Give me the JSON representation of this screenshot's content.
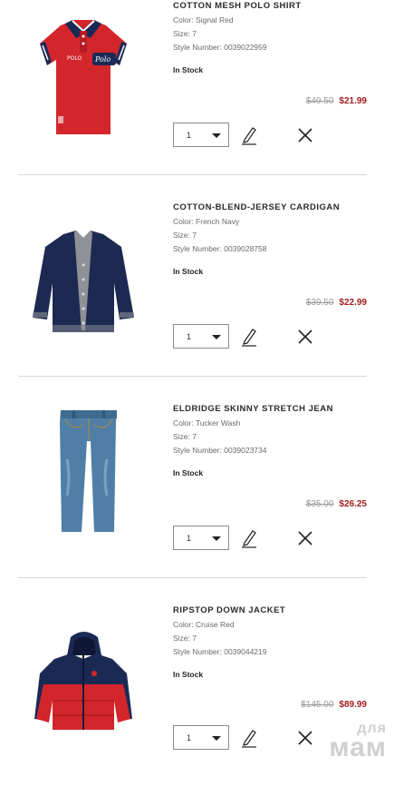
{
  "labels": {
    "color_prefix": "Color: ",
    "size_prefix": "Size: ",
    "style_prefix": "Style Number: "
  },
  "items": [
    {
      "name": "COTTON MESH POLO SHIRT",
      "color": "Signal Red",
      "size": "7",
      "style_number": "0039022959",
      "stock": "In Stock",
      "original_price": "$49.50",
      "sale_price": "$21.99",
      "quantity": "1",
      "image_icon": "polo-shirt-image"
    },
    {
      "name": "COTTON-BLEND-JERSEY CARDIGAN",
      "color": "French Navy",
      "size": "7",
      "style_number": "0039028758",
      "stock": "In Stock",
      "original_price": "$39.50",
      "sale_price": "$22.99",
      "quantity": "1",
      "image_icon": "cardigan-image"
    },
    {
      "name": "ELDRIDGE SKINNY STRETCH JEAN",
      "color": "Tucker Wash",
      "size": "7",
      "style_number": "0039023734",
      "stock": "In Stock",
      "original_price": "$35.00",
      "sale_price": "$26.25",
      "quantity": "1",
      "image_icon": "jeans-image"
    },
    {
      "name": "RIPSTOP DOWN JACKET",
      "color": "Cruise Red",
      "size": "7",
      "style_number": "0039044219",
      "stock": "In Stock",
      "original_price": "$145.00",
      "sale_price": "$89.99",
      "quantity": "1",
      "image_icon": "down-jacket-image"
    }
  ],
  "watermark": {
    "line1": "для",
    "line2": "мам"
  },
  "colors": {
    "sale": "#a11c1c",
    "strike": "#9a9a9a",
    "divider": "#d6d6d6"
  }
}
